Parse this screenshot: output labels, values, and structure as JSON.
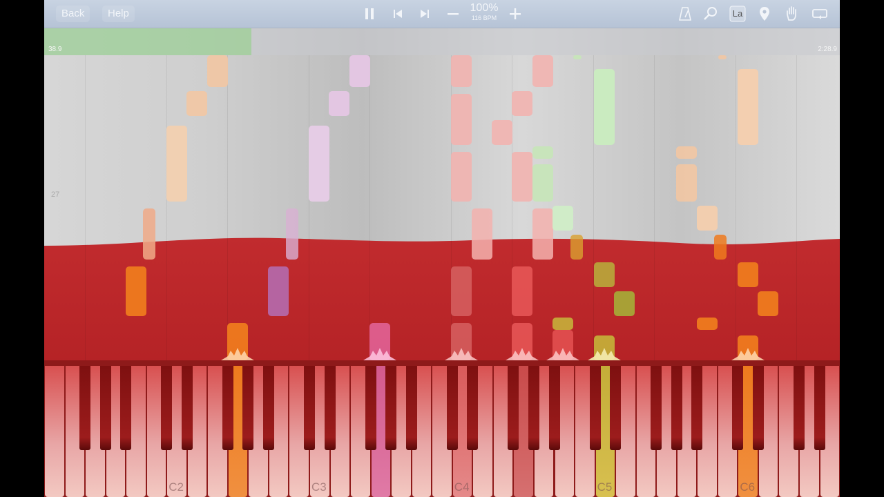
{
  "toolbar": {
    "back_label": "Back",
    "help_label": "Help",
    "zoom_percent": "100%",
    "tempo": "116 BPM",
    "icons": [
      "pause-icon",
      "skip-back-icon",
      "skip-forward-icon",
      "minus-icon",
      "plus-icon",
      "metronome-icon",
      "magnifier-icon",
      "la-label-icon",
      "pin-icon",
      "hand-icon",
      "loop-icon"
    ],
    "la_text": "La"
  },
  "timeline": {
    "current_time": "38.9",
    "total_time": "2:28.9",
    "progress": 0.26
  },
  "measure_number": "27",
  "keyboard": {
    "octave_labels": [
      "C2",
      "C3",
      "C4",
      "C5",
      "C6"
    ]
  },
  "colors": {
    "orange": "#ee7a1e",
    "peach": "#f6c9a0",
    "lilac": "#e6c6ea",
    "purple": "#b467a8",
    "pink": "#e26b8b",
    "red": "#e05252",
    "salmon": "#f4b6b0",
    "green": "#c7ecbf",
    "olive": "#b4a23a",
    "flag_red": "#b41f23"
  }
}
